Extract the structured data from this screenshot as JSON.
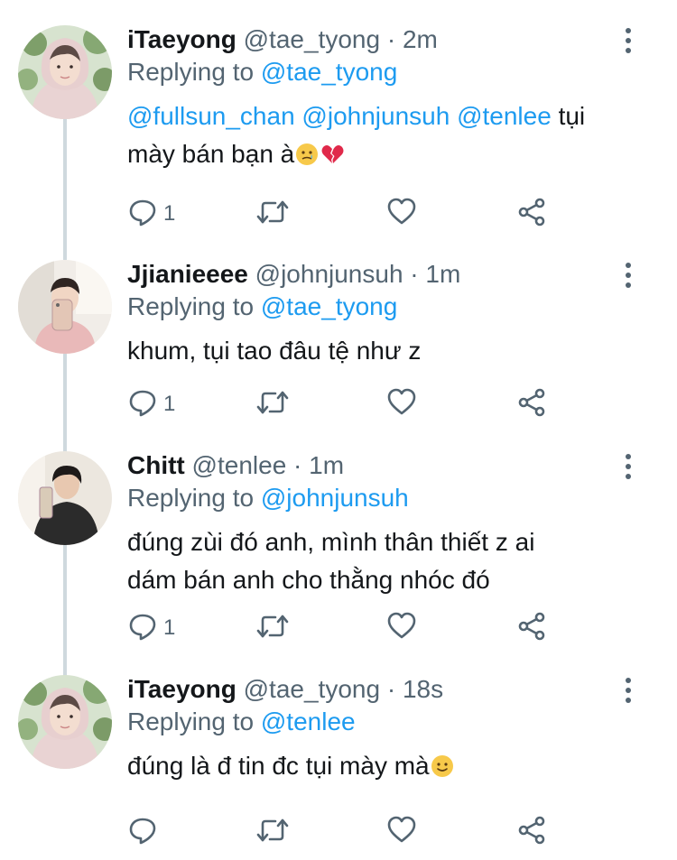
{
  "tweets": [
    {
      "name": "iTaeyong",
      "handle": "@tae_tyong",
      "time": "2m",
      "replying_prefix": "Replying to ",
      "replying_to": "@tae_tyong",
      "mentions": "@fullsun_chan @johnjunsuh @tenlee",
      "text_line1_tail": " tụi",
      "text_line2": "mày bán bạn à",
      "emojis": [
        "crying-face",
        "broken-heart"
      ],
      "reply_count": "1"
    },
    {
      "name": "Jjianieeee",
      "handle": "@johnjunsuh",
      "time": "1m",
      "replying_prefix": "Replying to ",
      "replying_to": "@tae_tyong",
      "text": "khum, tụi tao đâu tệ như z",
      "reply_count": "1"
    },
    {
      "name": "Chitt",
      "handle": "@tenlee",
      "time": "1m",
      "replying_prefix": "Replying to ",
      "replying_to": "@johnjunsuh",
      "text_line1": "đúng zùi đó anh, mình thân thiết z ai",
      "text_line2": "dám bán anh cho thằng nhóc đó",
      "reply_count": "1"
    },
    {
      "name": "iTaeyong",
      "handle": "@tae_tyong",
      "time": "18s",
      "replying_prefix": "Replying to ",
      "replying_to": "@tenlee",
      "text": "đúng là đ tin đc tụi mày mà",
      "emojis": [
        "slightly-smiling-face"
      ],
      "reply_count": ""
    }
  ],
  "separator": " · ",
  "colors": {
    "link": "#1d9bf0",
    "secondary_text": "#536471",
    "thread_line": "#cfd9de",
    "primary_text": "#14171a"
  },
  "icons": [
    "reply-icon",
    "retweet-icon",
    "like-icon",
    "share-icon",
    "more-options-icon"
  ]
}
